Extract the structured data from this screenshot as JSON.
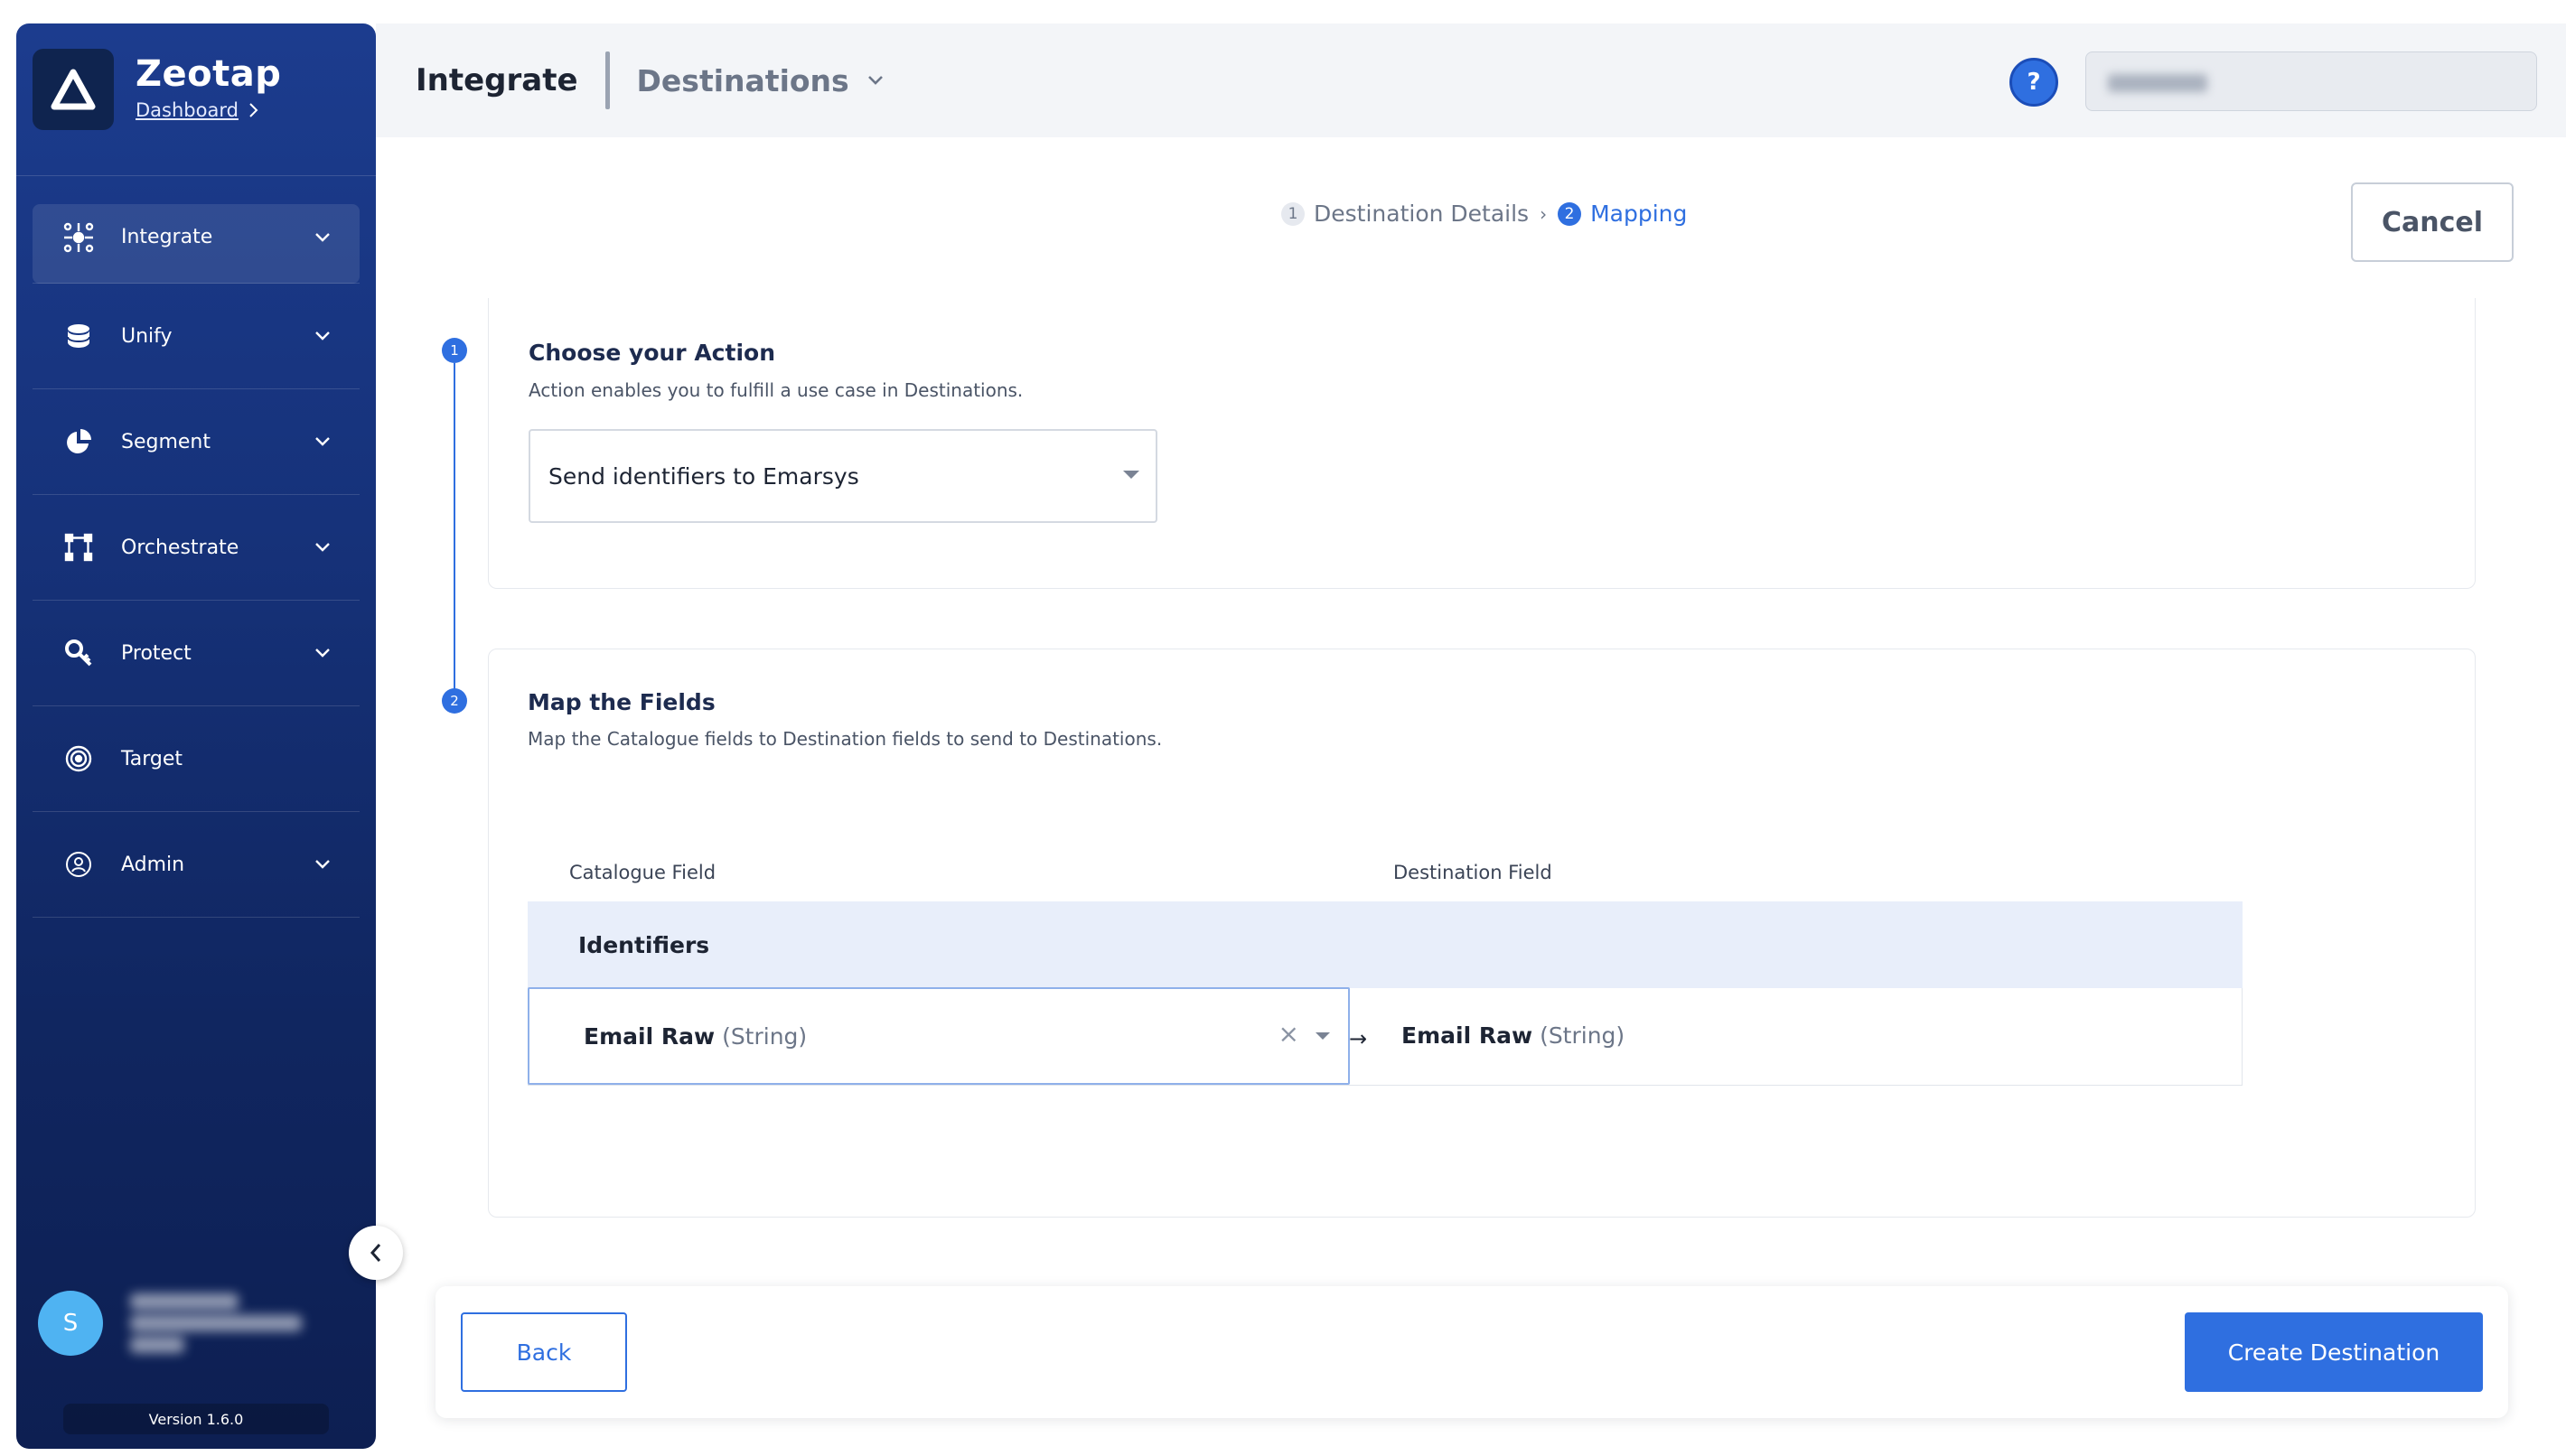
{
  "sidebar": {
    "brand": {
      "name": "Zeotap",
      "crumb": "Dashboard"
    },
    "items": [
      {
        "label": "Integrate",
        "icon": "integrate-icon",
        "active": true,
        "has_chevron": true
      },
      {
        "label": "Unify",
        "icon": "database-icon",
        "active": false,
        "has_chevron": true
      },
      {
        "label": "Segment",
        "icon": "pie-chart-icon",
        "active": false,
        "has_chevron": true
      },
      {
        "label": "Orchestrate",
        "icon": "workflow-icon",
        "active": false,
        "has_chevron": true
      },
      {
        "label": "Protect",
        "icon": "shield-key-icon",
        "active": false,
        "has_chevron": true
      },
      {
        "label": "Target",
        "icon": "target-icon",
        "active": false,
        "has_chevron": false
      },
      {
        "label": "Admin",
        "icon": "user-circle-icon",
        "active": false,
        "has_chevron": true
      }
    ],
    "user": {
      "avatar_initial": "S"
    },
    "version": "Version 1.6.0"
  },
  "header": {
    "title": "Integrate",
    "subtitle": "Destinations",
    "help": "?"
  },
  "stepper": {
    "steps": [
      {
        "num": "1",
        "label": "Destination Details",
        "active": false
      },
      {
        "num": "2",
        "label": "Mapping",
        "active": true
      }
    ],
    "separator": "›"
  },
  "cancel_label": "Cancel",
  "section_action": {
    "num": "1",
    "title": "Choose your Action",
    "description": "Action enables you to fulfill a use case in Destinations.",
    "selected_action": "Send identifiers to Emarsys"
  },
  "section_mapping": {
    "num": "2",
    "title": "Map the Fields",
    "description": "Map the Catalogue fields to Destination fields to send to Destinations.",
    "catalogue_header": "Catalogue Field",
    "destination_header": "Destination Field",
    "group": "Identifiers",
    "rows": [
      {
        "catalogue_field": "Email Raw",
        "catalogue_type": "(String)",
        "destination_field": "Email Raw",
        "destination_type": "(String)"
      }
    ],
    "clear_glyph": "×",
    "arrow_glyph": "→"
  },
  "footer": {
    "back_label": "Back",
    "create_label": "Create Destination"
  },
  "colors": {
    "primary": "#2f6fe0",
    "sidebar_top": "#1c3c8e",
    "sidebar_bottom": "#0d1f52",
    "avatar": "#4fb3f2"
  }
}
